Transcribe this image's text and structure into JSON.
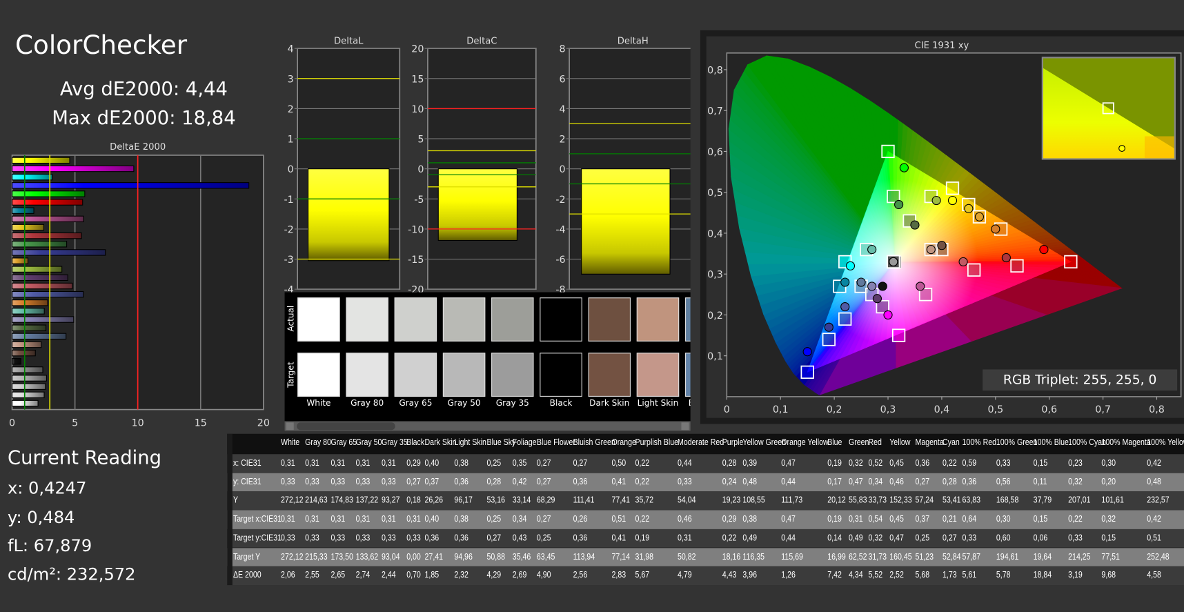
{
  "title": "ColorChecker",
  "summary": {
    "avg": "Avg dE2000: 4,44",
    "max": "Max dE2000: 18,84"
  },
  "current_reading": {
    "heading": "Current Reading",
    "x": "x: 0,4247",
    "y": "y: 0,484",
    "fl": "fL: 67,879",
    "cdm2": "cd/m²: 232,572"
  },
  "rgb_triplet": "RGB Triplet: 255, 255, 0",
  "swatches": {
    "actual_label": "Actual",
    "target_label": "Target",
    "items": [
      {
        "name": "White",
        "actual": "#ffffff",
        "target": "#ffffff"
      },
      {
        "name": "Gray 80",
        "actual": "#e3e4e2",
        "target": "#e4e4e4"
      },
      {
        "name": "Gray 65",
        "actual": "#cfd0cd",
        "target": "#d0d0d0"
      },
      {
        "name": "Gray 50",
        "actual": "#b9bab5",
        "target": "#b8b8b8"
      },
      {
        "name": "Gray 35",
        "actual": "#9d9e99",
        "target": "#9c9c9c"
      },
      {
        "name": "Black",
        "actual": "#000000",
        "target": "#000000"
      },
      {
        "name": "Dark Skin",
        "actual": "#6e5040",
        "target": "#735242"
      },
      {
        "name": "Light Skin",
        "actual": "#c0947e",
        "target": "#c4978a"
      },
      {
        "name": "Blue Sky",
        "actual": "#6080a0",
        "target": "#6283a8"
      }
    ]
  },
  "patch_colors": [
    "#ffffff",
    "#e0e0e0",
    "#cccccc",
    "#b5b5b5",
    "#999999",
    "#111111",
    "#735244",
    "#c29682",
    "#627a9d",
    "#576c43",
    "#8580b1",
    "#67bdaa",
    "#d67e2c",
    "#505ba6",
    "#c15a63",
    "#5e3c6c",
    "#9dbc40",
    "#e0a32e",
    "#383d96",
    "#469449",
    "#af363c",
    "#e7c71f",
    "#bb5695",
    "#0885a1",
    "#ff0000",
    "#00ff00",
    "#0000ff",
    "#00ffff",
    "#ff00ff",
    "#ffff00"
  ],
  "table": {
    "columns": [
      "White",
      "Gray 80",
      "Gray 65",
      "Gray 50",
      "Gray 35",
      "Black",
      "Dark Skin",
      "Light Skin",
      "Blue Sky",
      "Foliage",
      "Blue Flower",
      "Bluish Green",
      "Orange",
      "Purplish Blue",
      "Moderate Red",
      "Purple",
      "Yellow Green",
      "Orange Yellow",
      "Blue",
      "Green",
      "Red",
      "Yellow",
      "Magenta",
      "Cyan",
      "100% Red",
      "100% Green",
      "100% Blue",
      "100% Cyan",
      "100% Magenta",
      "100% Yellow"
    ],
    "rows": [
      {
        "label": "x: CIE31",
        "values": [
          "0,31",
          "0,31",
          "0,31",
          "0,31",
          "0,31",
          "0,29",
          "0,40",
          "0,38",
          "0,25",
          "0,35",
          "0,27",
          "0,27",
          "0,50",
          "0,22",
          "0,44",
          "0,28",
          "0,39",
          "0,47",
          "0,19",
          "0,32",
          "0,52",
          "0,45",
          "0,36",
          "0,22",
          "0,59",
          "0,33",
          "0,15",
          "0,23",
          "0,30",
          "0,42"
        ]
      },
      {
        "label": "y: CIE31",
        "values": [
          "0,33",
          "0,33",
          "0,33",
          "0,33",
          "0,33",
          "0,27",
          "0,37",
          "0,36",
          "0,28",
          "0,42",
          "0,27",
          "0,36",
          "0,41",
          "0,22",
          "0,33",
          "0,24",
          "0,48",
          "0,44",
          "0,17",
          "0,47",
          "0,34",
          "0,46",
          "0,27",
          "0,28",
          "0,36",
          "0,56",
          "0,11",
          "0,32",
          "0,20",
          "0,48"
        ]
      },
      {
        "label": "Y",
        "values": [
          "272,12",
          "214,63",
          "174,83",
          "137,22",
          "93,27",
          "0,18",
          "26,26",
          "96,17",
          "53,16",
          "33,14",
          "68,29",
          "111,41",
          "77,41",
          "35,72",
          "54,04",
          "19,23",
          "108,55",
          "111,73",
          "20,12",
          "55,83",
          "33,73",
          "152,33",
          "57,24",
          "53,41",
          "63,83",
          "168,58",
          "37,79",
          "207,01",
          "101,61",
          "232,57"
        ]
      },
      {
        "label": "Target x:CIE31",
        "values": [
          "0,31",
          "0,31",
          "0,31",
          "0,31",
          "0,31",
          "0,31",
          "0,40",
          "0,38",
          "0,25",
          "0,34",
          "0,27",
          "0,26",
          "0,51",
          "0,22",
          "0,46",
          "0,29",
          "0,38",
          "0,47",
          "0,19",
          "0,31",
          "0,54",
          "0,45",
          "0,37",
          "0,21",
          "0,64",
          "0,30",
          "0,15",
          "0,22",
          "0,32",
          "0,42"
        ]
      },
      {
        "label": "Target y:CIE31",
        "values": [
          "0,33",
          "0,33",
          "0,33",
          "0,33",
          "0,33",
          "0,33",
          "0,36",
          "0,36",
          "0,27",
          "0,43",
          "0,25",
          "0,36",
          "0,41",
          "0,19",
          "0,31",
          "0,22",
          "0,49",
          "0,44",
          "0,14",
          "0,49",
          "0,32",
          "0,47",
          "0,25",
          "0,27",
          "0,33",
          "0,60",
          "0,06",
          "0,33",
          "0,15",
          "0,51"
        ]
      },
      {
        "label": "Target Y",
        "values": [
          "272,12",
          "215,33",
          "173,50",
          "133,62",
          "93,04",
          "0,00",
          "27,41",
          "94,96",
          "50,88",
          "35,46",
          "63,45",
          "113,94",
          "77,14",
          "31,98",
          "50,82",
          "18,16",
          "116,35",
          "115,69",
          "16,99",
          "62,52",
          "31,73",
          "160,45",
          "51,23",
          "52,84",
          "57,87",
          "194,61",
          "19,64",
          "214,25",
          "77,51",
          "252,48"
        ]
      },
      {
        "label": "ΔE 2000",
        "values": [
          "2,06",
          "2,55",
          "2,65",
          "2,74",
          "2,44",
          "0,70",
          "1,85",
          "2,32",
          "4,29",
          "2,69",
          "4,90",
          "2,56",
          "2,83",
          "5,67",
          "4,79",
          "4,43",
          "3,96",
          "1,26",
          "7,42",
          "4,34",
          "5,52",
          "2,52",
          "5,68",
          "1,73",
          "5,61",
          "5,78",
          "18,84",
          "3,19",
          "9,68",
          "4,58"
        ]
      }
    ]
  },
  "chart_data": [
    {
      "type": "bar",
      "orientation": "horizontal",
      "title": "DeltaE 2000",
      "xlim": [
        0,
        20
      ],
      "xticks": [
        "0",
        "5",
        "10",
        "15",
        "20"
      ],
      "categories": [
        "White",
        "Gray 80",
        "Gray 65",
        "Gray 50",
        "Gray 35",
        "Black",
        "Dark Skin",
        "Light Skin",
        "Blue Sky",
        "Foliage",
        "Blue Flower",
        "Bluish Green",
        "Orange",
        "Purplish Blue",
        "Moderate Red",
        "Purple",
        "Yellow Green",
        "Orange Yellow",
        "Blue",
        "Green",
        "Red",
        "Yellow",
        "Magenta",
        "Cyan",
        "100% Red",
        "100% Green",
        "100% Blue",
        "100% Cyan",
        "100% Magenta",
        "100% Yellow"
      ],
      "values": [
        2.06,
        2.55,
        2.65,
        2.74,
        2.44,
        0.7,
        1.85,
        2.32,
        4.29,
        2.69,
        4.9,
        2.56,
        2.83,
        5.67,
        4.79,
        4.43,
        3.96,
        1.26,
        7.42,
        4.34,
        5.52,
        2.52,
        5.68,
        1.73,
        5.61,
        5.78,
        18.84,
        3.19,
        9.68,
        4.58
      ],
      "reference_lines": [
        {
          "value": 1,
          "color": "#008000"
        },
        {
          "value": 3,
          "color": "#e0e000"
        },
        {
          "value": 10,
          "color": "#ff2020"
        }
      ],
      "grid": true
    },
    {
      "type": "bar",
      "title": "DeltaL",
      "ylim": [
        -4,
        4
      ],
      "yticks": [
        "4",
        "3",
        "2",
        "1",
        "0",
        "-1",
        "-2",
        "-3",
        "-4"
      ],
      "tickvals": [
        4,
        3,
        2,
        1,
        0,
        -1,
        -2,
        -3,
        -4
      ],
      "value": -3.05,
      "reference_lines": [
        {
          "value": 3,
          "color": "#e0e000"
        },
        {
          "value": -3,
          "color": "#e0e000"
        },
        {
          "value": 1,
          "color": "#008000"
        },
        {
          "value": -1,
          "color": "#008000"
        }
      ]
    },
    {
      "type": "bar",
      "title": "DeltaC",
      "ylim": [
        -20,
        20
      ],
      "yticks": [
        "20",
        "15",
        "10",
        "5",
        "0",
        "-5",
        "-10",
        "-15",
        "-20"
      ],
      "tickvals": [
        20,
        15,
        10,
        5,
        0,
        -5,
        -10,
        -15,
        -20
      ],
      "value": -11.9,
      "reference_lines": [
        {
          "value": 10,
          "color": "#ff2020"
        },
        {
          "value": -10,
          "color": "#ff2020"
        },
        {
          "value": 3,
          "color": "#e0e000"
        },
        {
          "value": -3,
          "color": "#e0e000"
        },
        {
          "value": 1,
          "color": "#008000"
        },
        {
          "value": -1,
          "color": "#008000"
        }
      ]
    },
    {
      "type": "bar",
      "title": "DeltaH",
      "ylim": [
        -8,
        8
      ],
      "yticks": [
        "8",
        "6",
        "4",
        "2",
        "0",
        "-2",
        "-4",
        "-6",
        "-8"
      ],
      "tickvals": [
        8,
        6,
        4,
        2,
        0,
        -2,
        -4,
        -6,
        -8
      ],
      "value": -7.0,
      "reference_lines": [
        {
          "value": 3,
          "color": "#e0e000"
        },
        {
          "value": -3,
          "color": "#e0e000"
        },
        {
          "value": 1,
          "color": "#008000"
        },
        {
          "value": -1,
          "color": "#008000"
        }
      ]
    },
    {
      "type": "scatter",
      "title": "CIE 1931 xy",
      "xlim": [
        0,
        0.8
      ],
      "ylim": [
        0,
        0.85
      ],
      "xticks": [
        "0",
        "0,1",
        "0,2",
        "0,3",
        "0,4",
        "0,5",
        "0,6",
        "0,7",
        "0,8"
      ],
      "yticks": [
        "0,1",
        "0,2",
        "0,3",
        "0,4",
        "0,5",
        "0,6",
        "0,7",
        "0,8"
      ],
      "gamut": [
        [
          0.64,
          0.33
        ],
        [
          0.3,
          0.6
        ],
        [
          0.15,
          0.06
        ]
      ],
      "white_point": [
        0.3127,
        0.329
      ],
      "measured_marker": "circle",
      "target_marker": "square",
      "selected": "100% Yellow",
      "selected_measured": [
        0.4247,
        0.484
      ]
    }
  ]
}
